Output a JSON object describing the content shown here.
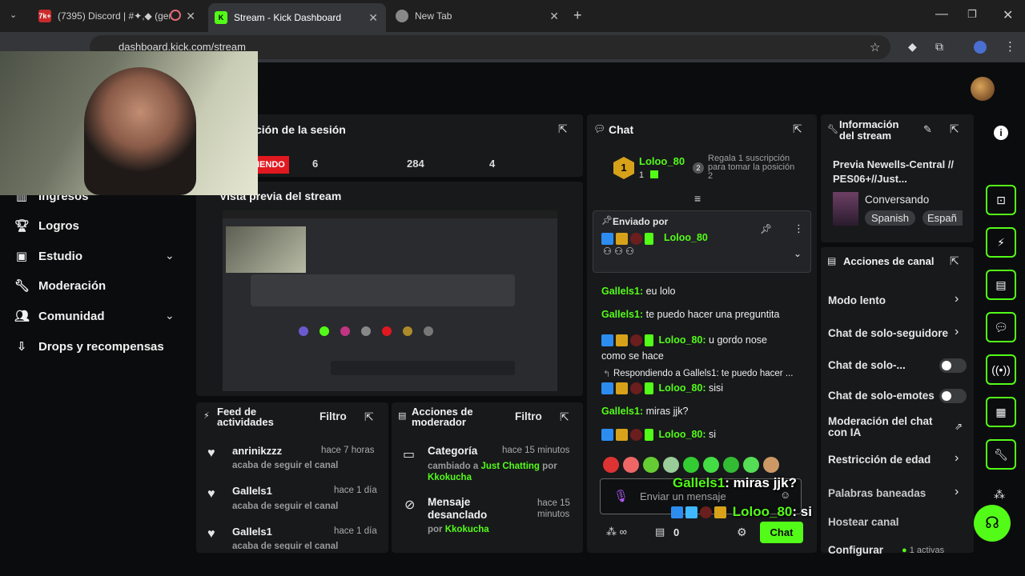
{
  "browser": {
    "tabs": [
      {
        "label": "(7395) Discord | #✦,◆ (gene",
        "fav": "7k+"
      },
      {
        "label": "Stream - Kick Dashboard",
        "fav": "K"
      },
      {
        "label": "New Tab",
        "fav": ""
      }
    ],
    "url": "dashboard.kick.com/stream"
  },
  "sidebar": {
    "items": [
      {
        "label": "Ingresos"
      },
      {
        "label": "Logros"
      },
      {
        "label": "Estudio"
      },
      {
        "label": "Moderación"
      },
      {
        "label": "Comunidad"
      },
      {
        "label": "Drops y recompensas"
      }
    ]
  },
  "session": {
    "title": "ción de la sesión",
    "live_badge": "IENDO",
    "stats": [
      "6",
      "284",
      "4"
    ]
  },
  "preview": {
    "title": "Vista previa del stream"
  },
  "chat": {
    "title": "Chat",
    "top_user": "Loloo_80",
    "top_rank": "1",
    "top_count": "1",
    "gift_rank": "2",
    "gift_text": "Regala 1 suscripción para tomar la posición 2",
    "pinned_label": "Enviado por",
    "pinned_user": "Loloo_80",
    "messages": [
      {
        "user": "Gallels1",
        "text": "eu lolo"
      },
      {
        "user": "Gallels1",
        "text": "te puedo hacer una preguntita"
      },
      {
        "user": "Loloo_80",
        "text": "u gordo nose como se hace"
      },
      {
        "reply": "Respondiendo a Gallels1: te puedo hacer ..."
      },
      {
        "user": "Loloo_80",
        "text": "sisi"
      },
      {
        "user": "Gallels1",
        "text": "miras jjk?"
      },
      {
        "user": "Loloo_80",
        "text": "si"
      }
    ],
    "input_placeholder": "Enviar un mensaje",
    "points": "0",
    "send_label": "Chat",
    "overlay_line1_user": "Gallels1",
    "overlay_line1_text": ": miras jjk?",
    "overlay_line2_user": "Loloo_80",
    "overlay_line2_text": ": si"
  },
  "stream_info": {
    "title_l1": "Información",
    "title_l2": "del stream",
    "stream_title": "Previa Newells-Central // PES06+//Just...",
    "category": "Conversando",
    "tags": [
      "Spanish",
      "Españ"
    ]
  },
  "channel_actions": {
    "title": "Acciones de canal",
    "items": [
      {
        "label": "Modo lento"
      },
      {
        "label": "Chat de solo-seguidore"
      },
      {
        "label": "Chat de solo-..."
      },
      {
        "label": "Chat de solo-emotes"
      },
      {
        "label": "Moderación del chat con IA"
      },
      {
        "label": "Restricción de edad"
      },
      {
        "label": "Palabras baneadas"
      },
      {
        "label": "Hostear canal"
      },
      {
        "label": "Configurar"
      }
    ],
    "active_count": "1 activas"
  },
  "activity_feed": {
    "title_l1": "Feed de",
    "title_l2": "actividades",
    "filter": "Filtro",
    "rows": [
      {
        "name": "anrinikzzz",
        "time": "hace 7 horas",
        "sub": "acaba de seguir el canal"
      },
      {
        "name": "Gallels1",
        "time": "hace 1 día",
        "sub": "acaba de seguir el canal"
      },
      {
        "name": "Gallels1",
        "time": "hace 1 día",
        "sub": "acaba de seguir el canal"
      }
    ]
  },
  "mod_actions": {
    "title_l1": "Acciones de",
    "title_l2": "moderador",
    "filter": "Filtro",
    "rows": [
      {
        "title": "Categoría",
        "time": "hace 15 minutos",
        "sub_prefix": "cambiado a",
        "sub_link": "Just Chatting",
        "sub_mid": "por",
        "sub_user": "Kkokucha"
      },
      {
        "title": "Mensaje desanclado",
        "time": "hace 15 minutos",
        "sub_mid": "por",
        "sub_user": "Kkokucha"
      }
    ]
  },
  "colors": {
    "accent": "#53fc18",
    "panel": "#18191b",
    "bg": "#0b0c0d"
  }
}
